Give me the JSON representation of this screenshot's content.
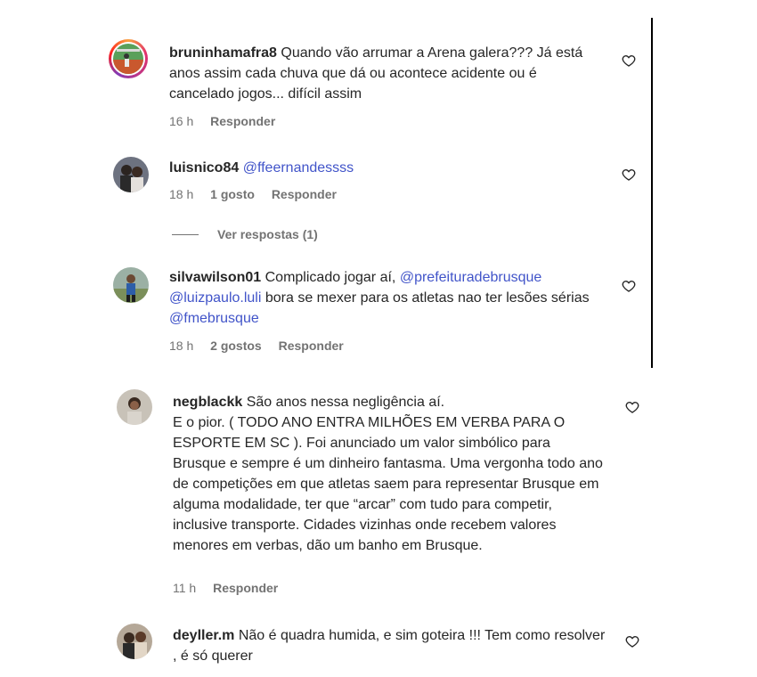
{
  "comments": [
    {
      "username": "bruninhamafra8",
      "text": "Quando vão arrumar a Arena galera??? Já está anos assim cada chuva que dá ou acontece acidente ou é cancelado jogos... difícil assim",
      "time": "16 h",
      "reply_label": "Responder"
    },
    {
      "username": "luisnico84",
      "mention": "@ffeernandessss",
      "time": "18 h",
      "likes": "1 gosto",
      "reply_label": "Responder"
    },
    {
      "username": "silvawilson01",
      "text_a": "Complicado jogar aí,",
      "mention_a": "@prefeituradebrusque",
      "mention_b": "@luizpaulo.luli",
      "text_b": "bora se mexer para os atletas nao ter lesões sérias",
      "mention_c": "@fmebrusque",
      "time": "18 h",
      "likes": "2 gostos",
      "reply_label": "Responder"
    },
    {
      "username": "negblackk",
      "line1": "São anos nessa negligência aí.",
      "line2": "E o pior. ( TODO ANO ENTRA MILHÕES EM VERBA PARA O ESPORTE EM SC ). Foi anunciado um valor simbólico para Brusque e sempre é um dinheiro fantasma. Uma vergonha todo ano de competições em que atletas saem para representar Brusque em alguma modalidade, ter que “arcar” com tudo para competir, inclusive transporte. Cidades vizinhas onde recebem valores menores em verbas, dão um banho em Brusque.",
      "time": "11 h",
      "reply_label": "Responder"
    },
    {
      "username": "deyller.m",
      "text": "Não é quadra humida, e sim goteira !!! Tem como resolver , é só querer"
    }
  ],
  "view_replies": "Ver respostas (1)",
  "colors": {
    "mention": "#4154c9",
    "meta": "#737373",
    "text": "#262626"
  },
  "icons": {
    "like": "heart-outline-icon"
  }
}
